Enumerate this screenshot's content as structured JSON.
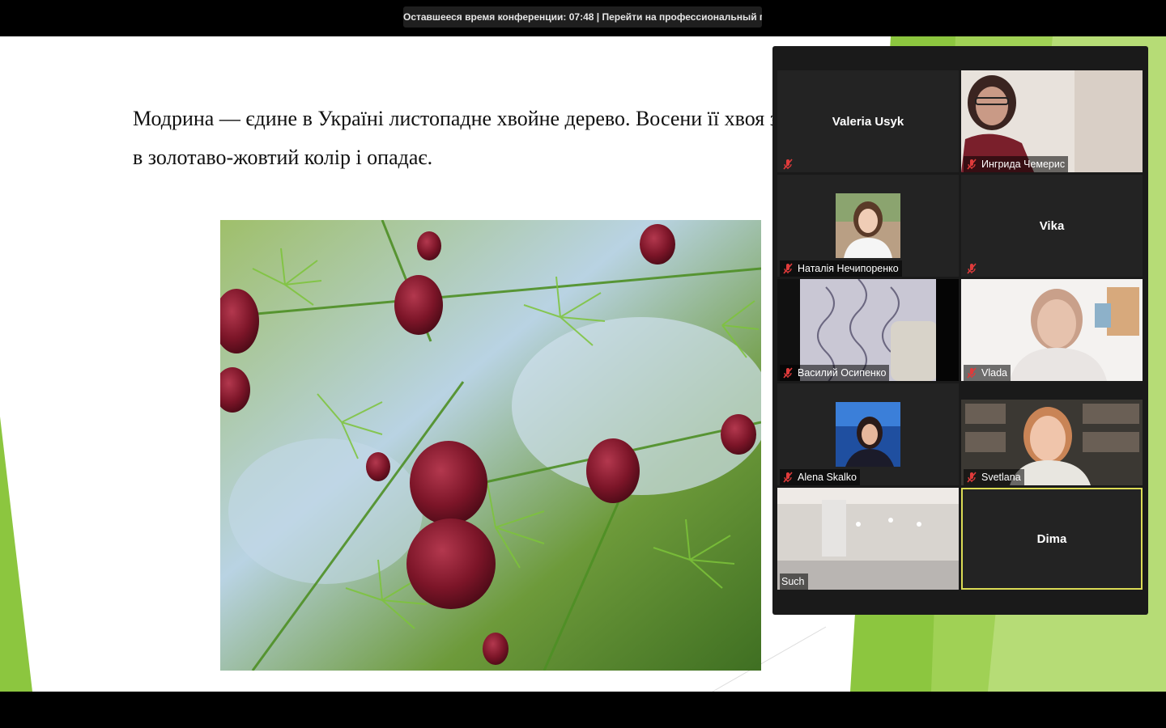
{
  "banner": {
    "text": "Оставшееся время конференции: 07:48 | Перейти на профессиональный план"
  },
  "slide": {
    "text": "Модрина — єдине в Україні листопадне хвойне дерево. Восени її хвоя забарвлюється в золотаво-жовтий колір і опадає.",
    "image_desc_icon": "larch-branch-photo"
  },
  "colors": {
    "slide_green": "#8cc63f",
    "gallery_bg": "#1a1a1a",
    "tile_bg": "#232323",
    "active_border": "#dbdb55",
    "mute_red": "#e03b3b"
  },
  "participants": [
    {
      "name": "Valeria Usyk",
      "muted": true,
      "mode": "name"
    },
    {
      "name": "Ингрида Чемерис",
      "muted": true,
      "mode": "video"
    },
    {
      "name": "Наталія Нечипоренко",
      "muted": true,
      "mode": "avatar"
    },
    {
      "name": "Vika",
      "muted": true,
      "mode": "name"
    },
    {
      "name": "Василий Осипенко",
      "muted": true,
      "mode": "video"
    },
    {
      "name": "Vlada",
      "muted": true,
      "mode": "video"
    },
    {
      "name": "Alena Skalko",
      "muted": true,
      "mode": "avatar"
    },
    {
      "name": "Svetlana",
      "muted": true,
      "mode": "video"
    },
    {
      "name": "Such",
      "muted": false,
      "mode": "video"
    },
    {
      "name": "Dima",
      "muted": false,
      "mode": "name",
      "active": true
    }
  ]
}
